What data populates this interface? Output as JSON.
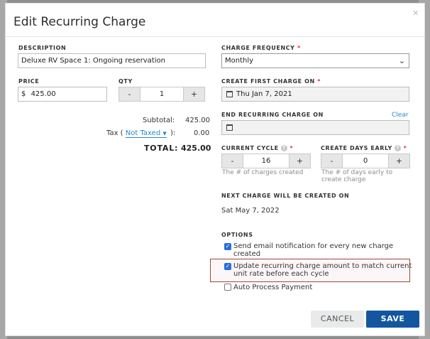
{
  "window": {
    "title": "Edit Recurring Charge"
  },
  "left": {
    "description": {
      "label": "DESCRIPTION",
      "value": "Deluxe RV Space 1: Ongoing reservation"
    },
    "price": {
      "label": "PRICE",
      "currency": "$",
      "value": "425.00"
    },
    "qty": {
      "label": "QTY",
      "minus": "-",
      "value": "1",
      "plus": "+"
    },
    "subtotal": {
      "label": "Subtotal:",
      "value": "425.00"
    },
    "tax": {
      "label_prefix": "Tax (",
      "link": "Not Taxed",
      "label_suffix": "):",
      "value": "0.00"
    },
    "total": {
      "label": "TOTAL:",
      "value": "425.00"
    }
  },
  "right": {
    "frequency": {
      "label": "CHARGE FREQUENCY",
      "required": "*",
      "value": "Monthly"
    },
    "first_charge": {
      "label": "CREATE FIRST CHARGE ON",
      "required": "*",
      "value": "Thu Jan 7, 2021"
    },
    "end_charge": {
      "label": "END RECURRING CHARGE ON",
      "clear": "Clear",
      "value": ""
    },
    "current_cycle": {
      "label": "CURRENT CYCLE",
      "help": "?",
      "required": "*",
      "minus": "-",
      "value": "16",
      "plus": "+",
      "hint": "The # of charges created"
    },
    "days_early": {
      "label": "CREATE DAYS EARLY",
      "help": "?",
      "required": "*",
      "minus": "-",
      "value": "0",
      "plus": "+",
      "hint_line1": "The # of days early to",
      "hint_line2": "create charge"
    },
    "next_charge": {
      "label": "NEXT CHARGE WILL BE CREATED ON",
      "value": "Sat May 7, 2022"
    },
    "options": {
      "label": "OPTIONS",
      "items": [
        {
          "line1": "Send email notification for every new charge",
          "line2": "created",
          "checked": true
        },
        {
          "line1": "Update recurring charge amount to match current",
          "line2": "unit rate before each cycle",
          "checked": true
        },
        {
          "line1": "Auto Process Payment",
          "line2": "",
          "checked": false
        }
      ]
    }
  },
  "footer": {
    "cancel": "CANCEL",
    "save": "SAVE"
  },
  "colors": {
    "primary": "#13569f",
    "link": "#2a88c8",
    "highlight_border": "#9a4b34",
    "checkbox": "#2b6fd6"
  }
}
